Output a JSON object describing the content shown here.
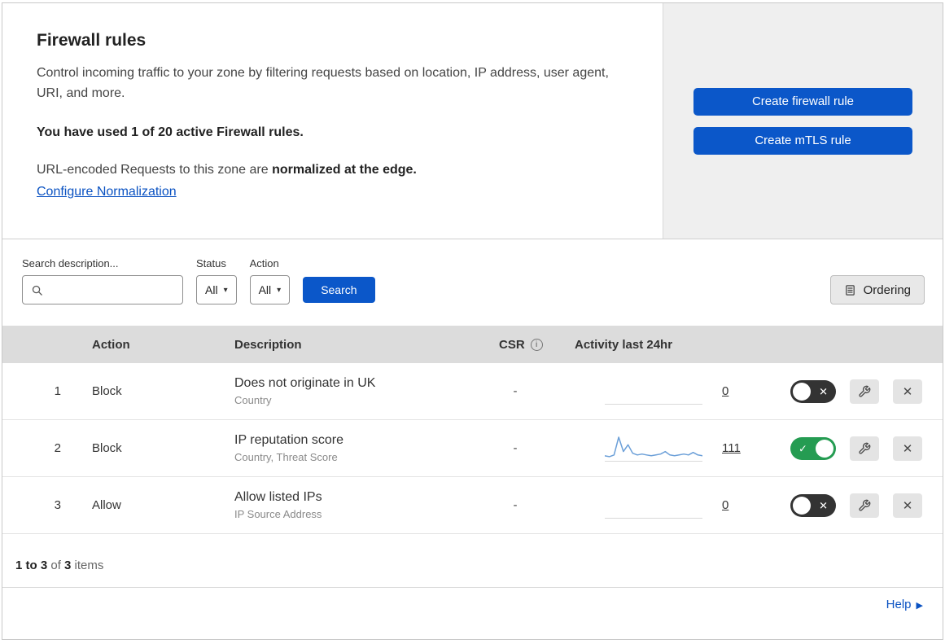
{
  "colors": {
    "primary_blue": "#0b57c9",
    "link_blue": "#0a52c2",
    "toggle_green": "#259c52",
    "toggle_off_bg": "#333333",
    "sparkline": "#6b9fd8"
  },
  "icons": {
    "toggle_on": "✓",
    "toggle_off": "✕",
    "close": "✕",
    "caret": "▾",
    "help_arrow": "▶",
    "info": "i"
  },
  "header": {
    "title": "Firewall rules",
    "description": "Control incoming traffic to your zone by filtering requests based on location, IP address, user agent, URI, and more.",
    "usage_text": "You have used 1 of 20 active Firewall rules.",
    "normalization_prefix": "URL-encoded Requests to this zone are ",
    "normalization_bold": "normalized at the edge.",
    "configure_link": "Configure Normalization",
    "buttons": {
      "create_firewall": "Create firewall rule",
      "create_mtls": "Create mTLS rule"
    }
  },
  "filters": {
    "search_label": "Search description...",
    "status_label": "Status",
    "status_value": "All",
    "action_label": "Action",
    "action_value": "All",
    "search_button": "Search",
    "ordering_button": "Ordering"
  },
  "table": {
    "columns": {
      "action": "Action",
      "description": "Description",
      "csr": "CSR",
      "activity": "Activity last 24hr"
    },
    "rows": [
      {
        "index": "1",
        "action": "Block",
        "description": "Does not originate in UK",
        "criteria": "Country",
        "csr": "-",
        "activity_count": "0",
        "enabled": false,
        "sparkline": []
      },
      {
        "index": "2",
        "action": "Block",
        "description": "IP reputation score",
        "criteria": "Country, Threat Score",
        "csr": "-",
        "activity_count": "111",
        "enabled": true,
        "sparkline": [
          5,
          4,
          6,
          27,
          10,
          18,
          8,
          6,
          7,
          6,
          5,
          6,
          7,
          10,
          6,
          5,
          6,
          7,
          6,
          9,
          6,
          5
        ]
      },
      {
        "index": "3",
        "action": "Allow",
        "description": "Allow listed IPs",
        "criteria": "IP Source Address",
        "csr": "-",
        "activity_count": "0",
        "enabled": false,
        "sparkline": []
      }
    ]
  },
  "footer": {
    "range": "1 to 3",
    "of": " of ",
    "total": "3",
    "items": " items",
    "help": "Help"
  }
}
